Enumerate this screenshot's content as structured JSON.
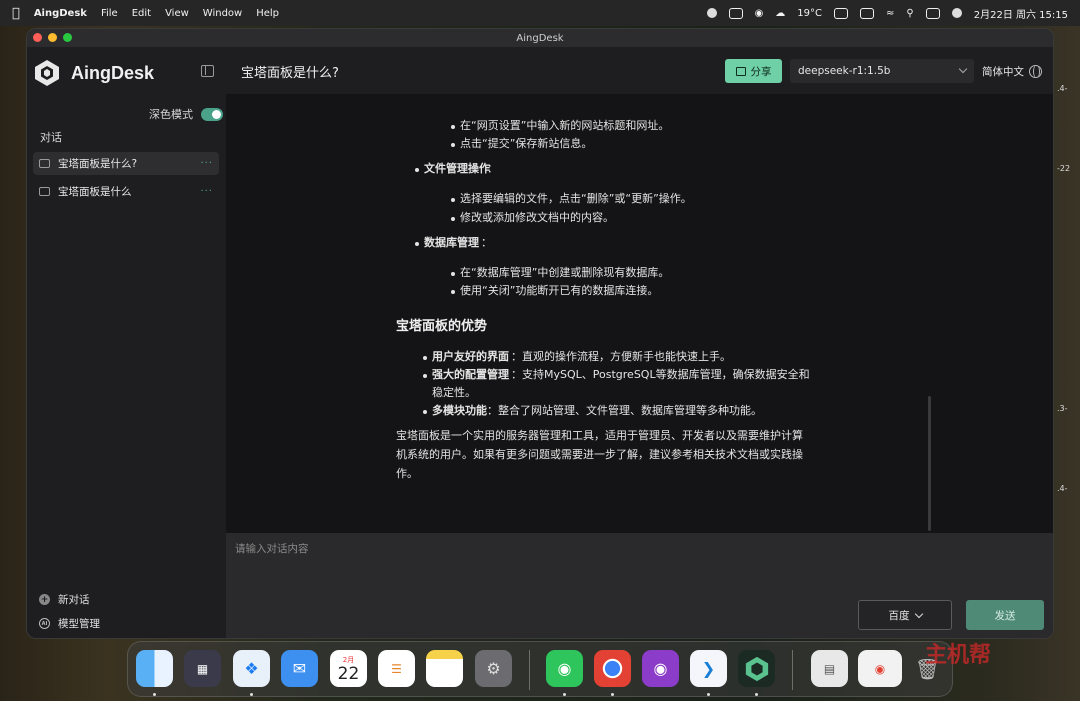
{
  "menubar": {
    "app": "AingDesk",
    "items": [
      "File",
      "Edit",
      "View",
      "Window",
      "Help"
    ],
    "weather": "19°C",
    "datetime": "2月22日 周六  15:15"
  },
  "window": {
    "title": "AingDesk"
  },
  "sidebar": {
    "brand": "AingDesk",
    "dark_mode_label": "深色模式",
    "dark_mode_on": true,
    "section_label": "对话",
    "conversations": [
      {
        "title": "宝塔面板是什么?",
        "active": true
      },
      {
        "title": "宝塔面板是什么",
        "active": false
      }
    ],
    "new_chat": "新对话",
    "model_manage": "模型管理"
  },
  "header": {
    "title": "宝塔面板是什么?",
    "share": "分享",
    "model": "deepseek-r1:1.5b",
    "language": "简体中文"
  },
  "message": {
    "lines": [
      "在“网页设置”中输入新的网站标题和网址。",
      "点击“提交”保存新站信息。",
      "文件管理操作",
      "：",
      "选择要编辑的文件，点击“删除”或“更新”操作。",
      "修改或添加修改文档中的内容。",
      "数据库管理",
      "：",
      "在“数据库管理”中创建或删除现有数据库。",
      "使用“关闭”功能断开已有的数据库连接。",
      "宝塔面板的优势",
      "用户友好的界面",
      "：直观的操作流程，方便新手也能快速上手。",
      "强大的配置管理",
      "：支持MySQL、PostgreSQL等数据库管理，确保数据安全和",
      "稳定性。",
      "多模块功能",
      "：整合了网站管理、文件管理、数据库管理等多种功能。",
      "宝塔面板是一个实用的服务器管理和工具，适用于管理员、开发者以及需要维护计算",
      "机系统的用户。如果有更多问题或需要进一步了解，建议参考相关技术文档或实践操",
      "作。"
    ]
  },
  "input": {
    "placeholder": "请输入对话内容",
    "search_engine": "百度",
    "send": "发送"
  },
  "edge_labels": [
    ".4-",
    "-22",
    ".3-",
    ".4-"
  ],
  "dock": {
    "calendar_month": "2月",
    "calendar_day": "22"
  },
  "watermark": "主机帮"
}
